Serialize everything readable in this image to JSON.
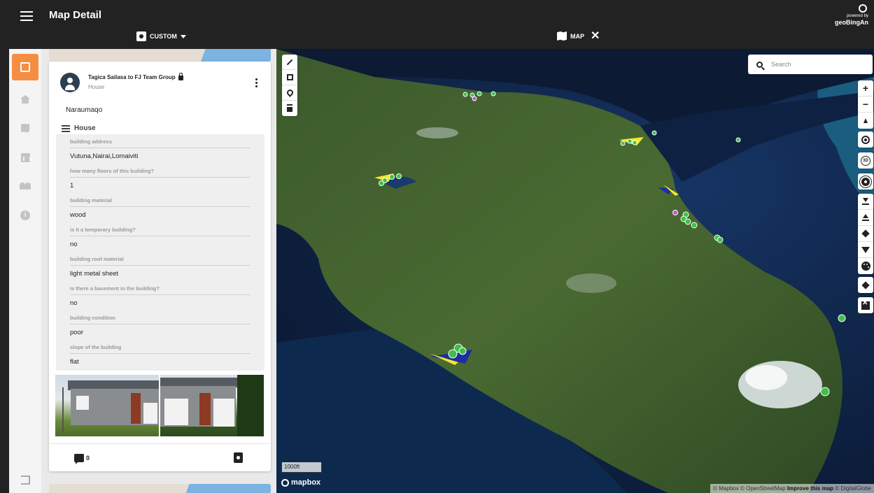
{
  "header": {
    "title": "Map Detail",
    "powered_small": "powered by",
    "powered_brand": "geoBingAn",
    "custom_label": "CUSTOM",
    "map_tab_label": "MAP"
  },
  "post": {
    "author": "Tagica Sailasa to FJ Team Group",
    "type": "House",
    "place": "Naraumaqo",
    "section": "House",
    "fields": [
      {
        "label": "building address",
        "value": "Vutuna,Nairai,Lomaiviti"
      },
      {
        "label": "how many floors of this building?",
        "value": "1"
      },
      {
        "label": "building material",
        "value": "wood"
      },
      {
        "label": "is it a temporary building?",
        "value": "no"
      },
      {
        "label": "building roof material",
        "value": "light metal sheet"
      },
      {
        "label": "Is there a basement in the building?",
        "value": "no"
      },
      {
        "label": "building condition",
        "value": "poor"
      },
      {
        "label": "slope of the building",
        "value": "flat"
      }
    ],
    "comment_count": "0"
  },
  "map": {
    "search_placeholder": "Search",
    "scale": "1000ft",
    "logo": "mapbox",
    "attribution_1": "© Mapbox © OpenStreetMap",
    "attribution_2": "Improve this map",
    "attribution_3": "© DigitalGlobe",
    "zoom_in": "+",
    "zoom_out": "−",
    "d3_label": "3D"
  },
  "icons": {
    "rail": [
      "edit-icon",
      "home-icon",
      "map-icon",
      "chart-icon",
      "people-icon",
      "info-icon",
      "logout-icon"
    ],
    "accent": "#f58d42"
  }
}
